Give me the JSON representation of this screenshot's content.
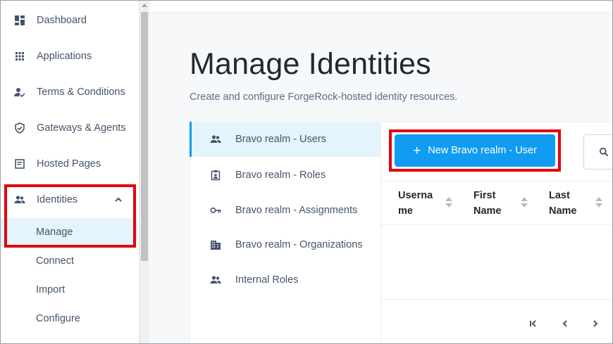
{
  "sidebar": {
    "items": [
      {
        "label": "Dashboard",
        "icon": "dashboard-icon"
      },
      {
        "label": "Applications",
        "icon": "apps-grid-icon"
      },
      {
        "label": "Terms & Conditions",
        "icon": "user-check-icon"
      },
      {
        "label": "Gateways & Agents",
        "icon": "shield-icon"
      },
      {
        "label": "Hosted Pages",
        "icon": "page-icon"
      },
      {
        "label": "Identities",
        "icon": "people-icon",
        "expanded": true
      }
    ],
    "identities_sub": [
      {
        "label": "Manage",
        "active": true
      },
      {
        "label": "Connect"
      },
      {
        "label": "Import"
      },
      {
        "label": "Configure"
      }
    ]
  },
  "main": {
    "title": "Manage Identities",
    "subtitle": "Create and configure ForgeRock-hosted identity resources."
  },
  "realm_list": [
    {
      "label": "Bravo realm - Users",
      "icon": "people-icon",
      "active": true
    },
    {
      "label": "Bravo realm - Roles",
      "icon": "badge-icon"
    },
    {
      "label": "Bravo realm - Assignments",
      "icon": "key-icon"
    },
    {
      "label": "Bravo realm - Organizations",
      "icon": "building-icon"
    },
    {
      "label": "Internal Roles",
      "icon": "people-icon"
    }
  ],
  "toolbar": {
    "new_button_label": "New Bravo realm - User",
    "plus": "+"
  },
  "table": {
    "columns": [
      {
        "line1": "Userna",
        "line2": "me"
      },
      {
        "line1": "First",
        "line2": "Name"
      },
      {
        "line1": "Last",
        "line2": "Name"
      }
    ]
  },
  "colors": {
    "primary": "#109cf1",
    "highlight": "#e3000f",
    "active_bg": "#e4f4fd",
    "text": "#455469"
  }
}
